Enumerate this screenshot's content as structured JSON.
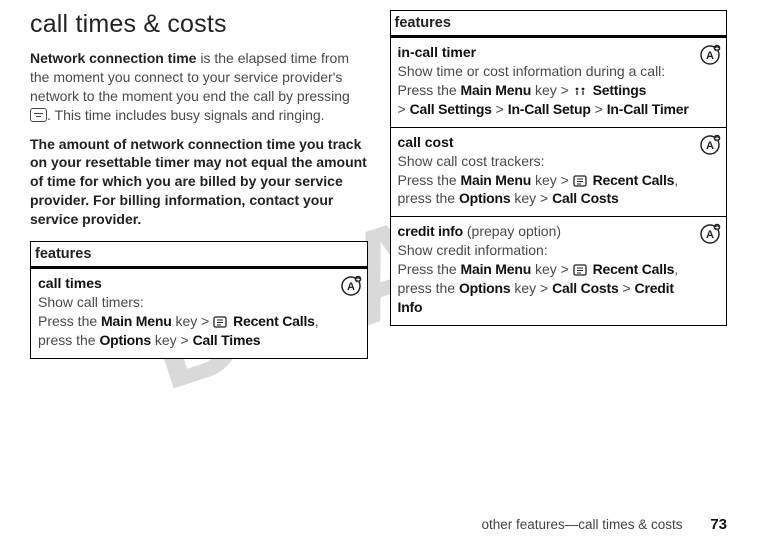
{
  "watermark": "DRAFT",
  "heading": "call times & costs",
  "para1": {
    "lead": "Network connection time",
    "rest_a": " is the elapsed time from the moment you connect to your service provider's network to the moment you end the call by pressing ",
    "rest_b": ". This time includes busy signals and ringing."
  },
  "para2": "The amount of network connection time you track on your resettable timer may not equal the amount of time for which you are billed by your service provider. For billing information, contact your service provider.",
  "left_table": {
    "header": "features",
    "rows": [
      {
        "title": "call times",
        "body": "Show call timers:",
        "press_a": "Press the ",
        "k1": "Main Menu",
        "mid1": " key > ",
        "icon1": "recent-calls-icon",
        "k2": "Recent Calls",
        "mid2": ", press the ",
        "k3": "Options",
        "mid3": " key > ",
        "k4": "Call Times"
      }
    ]
  },
  "right_table": {
    "header": "features",
    "rows": [
      {
        "title": "in-call timer",
        "body": "Show time or cost information during a call:",
        "press_a": "Press the ",
        "k1": "Main Menu",
        "mid1": " key > ",
        "icon1": "settings-icon",
        "k2": "Settings",
        "mid2": " > ",
        "k3": "Call Settings",
        "mid3": " > ",
        "k4": "In-Call Setup",
        "mid4": " > ",
        "k5": "In-Call Timer"
      },
      {
        "title": "call cost",
        "body": "Show call cost trackers:",
        "press_a": "Press the ",
        "k1": "Main Menu",
        "mid1": " key > ",
        "icon1": "recent-calls-icon",
        "k2": "Recent Calls",
        "mid2": ", press the ",
        "k3": "Options",
        "mid3": " key > ",
        "k4": "Call Costs"
      },
      {
        "title_a": "credit info",
        "title_b": " (prepay option)",
        "body": "Show credit information:",
        "press_a": "Press the ",
        "k1": "Main Menu",
        "mid1": " key > ",
        "icon1": "recent-calls-icon",
        "k2": "Recent Calls",
        "mid2": ", press the ",
        "k3": "Options",
        "mid3": " key > ",
        "k4": "Call Costs",
        "mid4": " > ",
        "k5": "Credit Info"
      }
    ]
  },
  "footer": {
    "section": "other features—call times & costs",
    "page": "73"
  },
  "icons": {
    "badge_letter": "A",
    "plus": "+"
  }
}
